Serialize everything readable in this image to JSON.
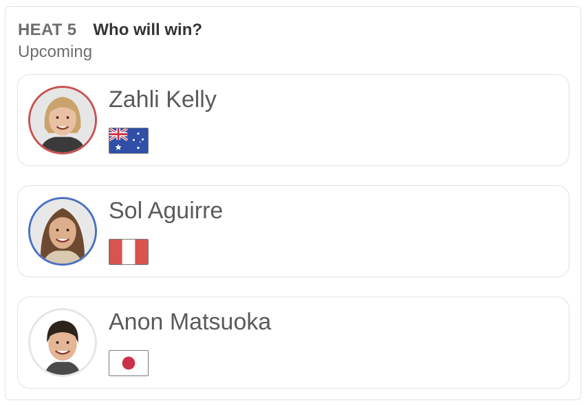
{
  "heat": {
    "label": "HEAT 5",
    "question": "Who will win?",
    "status": "Upcoming"
  },
  "surfers": [
    {
      "name": "Zahli Kelly",
      "flag_icon": "australia-flag-icon",
      "ring_color": "#c9524f",
      "skin": "#e9c1a2",
      "hair": "#c9a36b",
      "suit": "#3a3a3a"
    },
    {
      "name": "Sol Aguirre",
      "flag_icon": "peru-flag-icon",
      "ring_color": "#4a70c4",
      "skin": "#dcae8c",
      "hair": "#6d4a2f",
      "suit": "#d9c9b0"
    },
    {
      "name": "Anon Matsuoka",
      "flag_icon": "japan-flag-icon",
      "ring_color": "#e6e6e6",
      "skin": "#e4b597",
      "hair": "#2d231c",
      "suit": "#4a4a4a"
    }
  ],
  "colors": {
    "peru_red": "#d9534f",
    "japan_red": "#c8324a",
    "australia_blue": "#2f4fa8"
  }
}
